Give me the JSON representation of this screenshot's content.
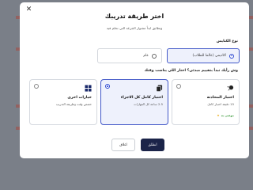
{
  "dialog": {
    "title": "اختر طريقة تدريبك",
    "subtitle": "وتطابق ابدأ مشوار الجرعة التي تحلم فيه",
    "close_icon": "close-icon"
  },
  "test_type": {
    "label": "نوع الكنايس",
    "options": [
      {
        "label": "اكاديمي (عالما للطلاب)",
        "selected": true
      },
      {
        "label": "عام",
        "selected": false
      }
    ]
  },
  "method": {
    "label": "وش رأيك تبدأ بتقييم مبدئي؟ اختار اللي يناسب وقتك",
    "cards": [
      {
        "title": "اختبار المحادثة",
        "desc": "15 دقيقة اختبار كامل",
        "tag": "موصى به",
        "icon": "chat-icon",
        "selected": false
      },
      {
        "title": "اختبار كامل كل الاجزاء",
        "desc": "2.5 ساعة كل المهارات",
        "tag": "",
        "icon": "copy-icon",
        "selected": true
      },
      {
        "title": "خيارات اخرى",
        "desc": "خصص وقت وطريقة التدريب",
        "tag": "",
        "icon": "grid-icon",
        "selected": false
      }
    ]
  },
  "footer": {
    "primary_label": "انطلق",
    "secondary_label": "اغلاق"
  },
  "colors": {
    "accent": "#2f4bd2",
    "primary_button": "#1b2449",
    "selected_bg": "#eef1fc"
  }
}
